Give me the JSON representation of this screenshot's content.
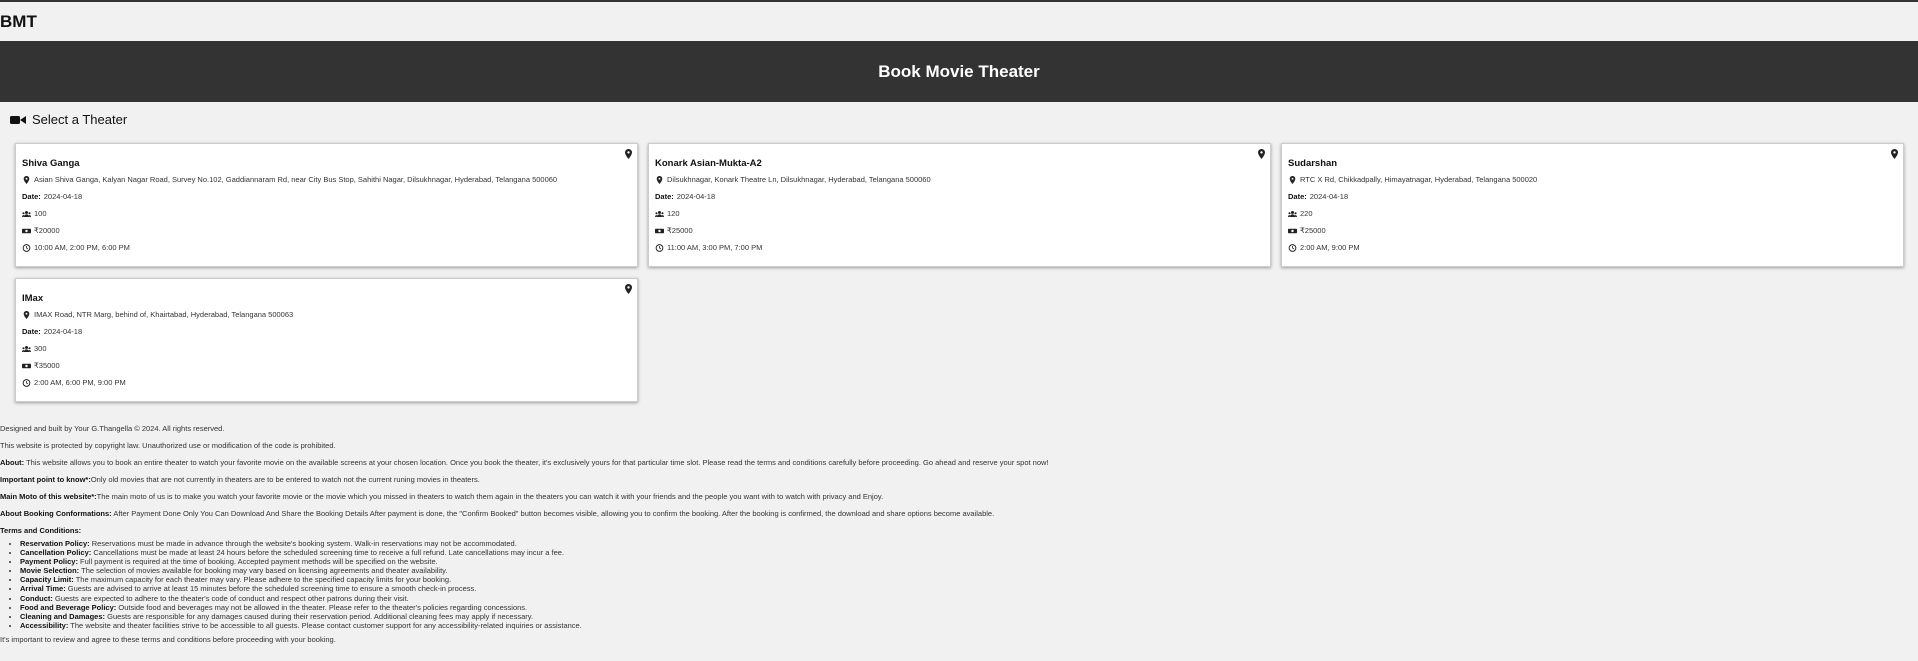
{
  "brand": "BMT",
  "banner_title": "Book Movie Theater",
  "select_heading": "Select a Theater",
  "date_label": "Date:",
  "theaters": [
    {
      "name": "Shiva Ganga",
      "address": "Asian Shiva Ganga, Kalyan Nagar Road, Survey No.102, Gaddiannaram Rd, near City Bus Stop, Sahithi Nagar, Dilsukhnagar, Hyderabad, Telangana 500060",
      "date": "2024-04-18",
      "capacity": "100",
      "price": "₹20000",
      "times": "10:00 AM, 2:00 PM, 6:00 PM"
    },
    {
      "name": "Konark Asian-Mukta-A2",
      "address": "Dilsukhnagar, Konark Theatre Ln, Dilsukhnagar, Hyderabad, Telangana 500060",
      "date": "2024-04-18",
      "capacity": "120",
      "price": "₹25000",
      "times": "11:00 AM, 3:00 PM, 7:00 PM"
    },
    {
      "name": "Sudarshan",
      "address": "RTC X Rd, Chikkadpally, Himayatnagar, Hyderabad, Telangana 500020",
      "date": "2024-04-18",
      "capacity": "220",
      "price": "₹25000",
      "times": "2:00 AM, 9:00 PM"
    },
    {
      "name": "IMax",
      "address": "IMAX Road, NTR Marg, behind of, Khairtabad, Hyderabad, Telangana 500063",
      "date": "2024-04-18",
      "capacity": "300",
      "price": "₹35000",
      "times": "2:00 AM, 6:00 PM, 9:00 PM"
    }
  ],
  "footer": {
    "credit": "Designed and built by Your G.Thangella © 2024. All rights reserved.",
    "copyright": "This website is protected by copyright law. Unauthorized use or modification of the code is prohibited.",
    "about_label": "About:",
    "about_text": " This website allows you to book an entire theater to watch your favorite movie on the available screens at your chosen location. Once you book the theater, it's exclusively yours for that particular time slot. Please read the terms and conditions carefully before proceeding. Go ahead and reserve your spot now!",
    "important_label": "Important point to know*:",
    "important_text": "Only old movies that are not currently in theaters are to be entered to watch not the current runing movies in theaters.",
    "moto_label": "Main Moto of this website*:",
    "moto_text": "The main moto of us is to make you watch your favorite movie or the movie which you missed in theaters to watch them again in the theaters you can watch it with your friends and the people you want with to watch with privacy and Enjoy.",
    "booking_label": "About Booking Conformations:",
    "booking_text": " After Payment Done Only You Can Download And Share the Booking Details After payment is done, the \"Confirm Booked\" button becomes visible, allowing you to confirm the booking. After the booking is confirmed, the download and share options become available.",
    "terms_label": "Terms and Conditions:",
    "terms": [
      {
        "label": "Reservation Policy:",
        "text": " Reservations must be made in advance through the website's booking system. Walk-in reservations may not be accommodated."
      },
      {
        "label": "Cancellation Policy:",
        "text": " Cancellations must be made at least 24 hours before the scheduled screening time to receive a full refund. Late cancellations may incur a fee."
      },
      {
        "label": "Payment Policy:",
        "text": " Full payment is required at the time of booking. Accepted payment methods will be specified on the website."
      },
      {
        "label": "Movie Selection:",
        "text": " The selection of movies available for booking may vary based on licensing agreements and theater availability."
      },
      {
        "label": "Capacity Limit:",
        "text": " The maximum capacity for each theater may vary. Please adhere to the specified capacity limits for your booking."
      },
      {
        "label": "Arrival Time:",
        "text": " Guests are advised to arrive at least 15 minutes before the scheduled screening time to ensure a smooth check-in process."
      },
      {
        "label": "Conduct:",
        "text": " Guests are expected to adhere to the theater's code of conduct and respect other patrons during their visit."
      },
      {
        "label": "Food and Beverage Policy:",
        "text": " Outside food and beverages may not be allowed in the theater. Please refer to the theater's policies regarding concessions."
      },
      {
        "label": "Cleaning and Damages:",
        "text": " Guests are responsible for any damages caused during their reservation period. Additional cleaning fees may apply if necessary."
      },
      {
        "label": "Accessibility:",
        "text": " The website and theater facilities strive to be accessible to all guests. Please contact customer support for any accessibility-related inquiries or assistance."
      }
    ],
    "closing": "It's important to review and agree to these terms and conditions before proceeding with your booking."
  }
}
